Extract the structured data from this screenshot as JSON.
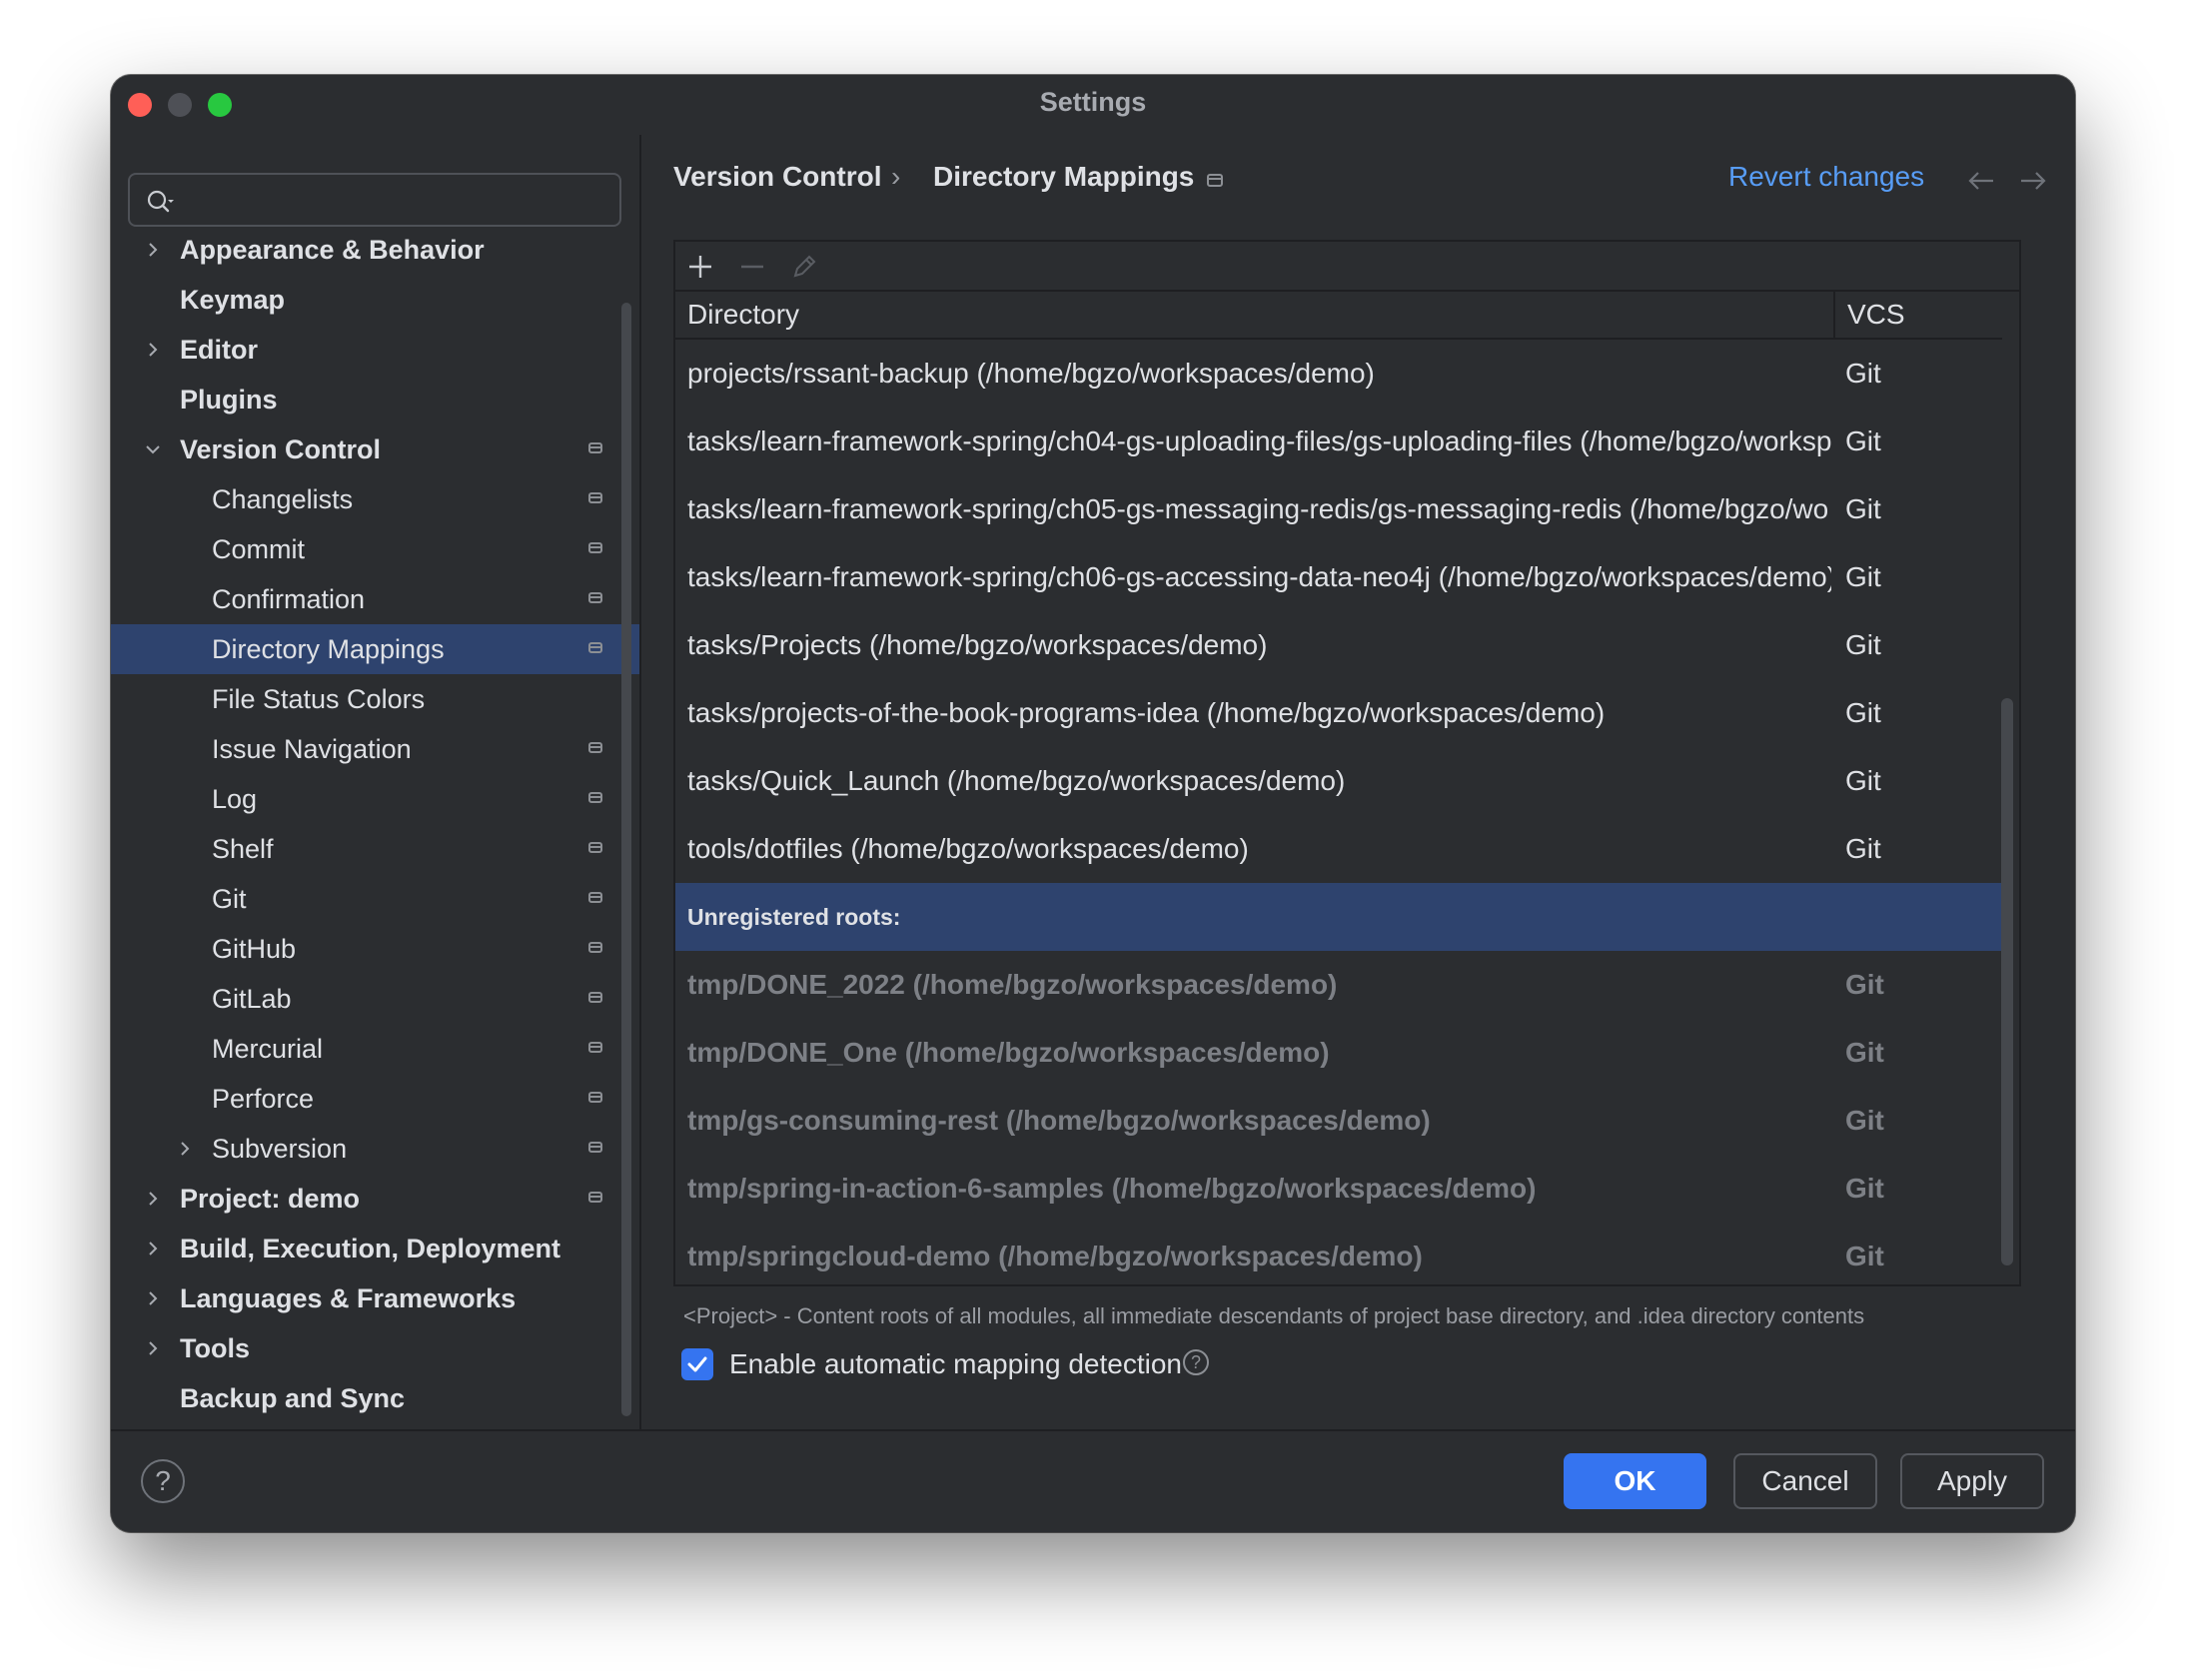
{
  "window": {
    "title": "Settings"
  },
  "search": {
    "placeholder": "",
    "value": ""
  },
  "sidebar": {
    "items": [
      {
        "label": "Appearance & Behavior",
        "level": 0,
        "expandable": true,
        "expanded": false,
        "badge": false,
        "selected": false
      },
      {
        "label": "Keymap",
        "level": 0,
        "expandable": false,
        "badge": false,
        "selected": false
      },
      {
        "label": "Editor",
        "level": 0,
        "expandable": true,
        "expanded": false,
        "badge": false,
        "selected": false
      },
      {
        "label": "Plugins",
        "level": 0,
        "expandable": false,
        "badge": false,
        "selected": false
      },
      {
        "label": "Version Control",
        "level": 0,
        "expandable": true,
        "expanded": true,
        "badge": true,
        "selected": false
      },
      {
        "label": "Changelists",
        "level": 1,
        "expandable": false,
        "badge": true,
        "selected": false
      },
      {
        "label": "Commit",
        "level": 1,
        "expandable": false,
        "badge": true,
        "selected": false
      },
      {
        "label": "Confirmation",
        "level": 1,
        "expandable": false,
        "badge": true,
        "selected": false
      },
      {
        "label": "Directory Mappings",
        "level": 1,
        "expandable": false,
        "badge": true,
        "selected": true
      },
      {
        "label": "File Status Colors",
        "level": 1,
        "expandable": false,
        "badge": false,
        "selected": false
      },
      {
        "label": "Issue Navigation",
        "level": 1,
        "expandable": false,
        "badge": true,
        "selected": false
      },
      {
        "label": "Log",
        "level": 1,
        "expandable": false,
        "badge": true,
        "selected": false
      },
      {
        "label": "Shelf",
        "level": 1,
        "expandable": false,
        "badge": true,
        "selected": false
      },
      {
        "label": "Git",
        "level": 1,
        "expandable": false,
        "badge": true,
        "selected": false
      },
      {
        "label": "GitHub",
        "level": 1,
        "expandable": false,
        "badge": true,
        "selected": false
      },
      {
        "label": "GitLab",
        "level": 1,
        "expandable": false,
        "badge": true,
        "selected": false
      },
      {
        "label": "Mercurial",
        "level": 1,
        "expandable": false,
        "badge": true,
        "selected": false
      },
      {
        "label": "Perforce",
        "level": 1,
        "expandable": false,
        "badge": true,
        "selected": false
      },
      {
        "label": "Subversion",
        "level": 1,
        "expandable": true,
        "expanded": false,
        "badge": true,
        "selected": false
      },
      {
        "label": "Project: demo",
        "level": 0,
        "expandable": true,
        "expanded": false,
        "badge": true,
        "selected": false
      },
      {
        "label": "Build, Execution, Deployment",
        "level": 0,
        "expandable": true,
        "expanded": false,
        "badge": false,
        "selected": false
      },
      {
        "label": "Languages & Frameworks",
        "level": 0,
        "expandable": true,
        "expanded": false,
        "badge": false,
        "selected": false
      },
      {
        "label": "Tools",
        "level": 0,
        "expandable": true,
        "expanded": false,
        "badge": false,
        "selected": false
      },
      {
        "label": "Backup and Sync",
        "level": 0,
        "expandable": false,
        "badge": false,
        "selected": false
      }
    ]
  },
  "header": {
    "breadcrumb": [
      "Version Control",
      "Directory Mappings"
    ],
    "separator": "›",
    "revert_label": "Revert changes"
  },
  "toolbar": {
    "add_icon": "plus-icon",
    "remove_icon": "minus-icon",
    "edit_icon": "pencil-icon"
  },
  "table": {
    "columns": [
      "Directory",
      "VCS"
    ],
    "rows": [
      {
        "directory": "projects/rssant-backup (/home/bgzo/workspaces/demo)",
        "vcs": "Git",
        "kind": "registered"
      },
      {
        "directory": "tasks/learn-framework-spring/ch04-gs-uploading-files/gs-uploading-files (/home/bgzo/worksp",
        "vcs": "Git",
        "kind": "registered"
      },
      {
        "directory": "tasks/learn-framework-spring/ch05-gs-messaging-redis/gs-messaging-redis (/home/bgzo/wo",
        "vcs": "Git",
        "kind": "registered"
      },
      {
        "directory": "tasks/learn-framework-spring/ch06-gs-accessing-data-neo4j (/home/bgzo/workspaces/demo)",
        "vcs": "Git",
        "kind": "registered"
      },
      {
        "directory": "tasks/Projects (/home/bgzo/workspaces/demo)",
        "vcs": "Git",
        "kind": "registered"
      },
      {
        "directory": "tasks/projects-of-the-book-programs-idea (/home/bgzo/workspaces/demo)",
        "vcs": "Git",
        "kind": "registered"
      },
      {
        "directory": "tasks/Quick_Launch (/home/bgzo/workspaces/demo)",
        "vcs": "Git",
        "kind": "registered"
      },
      {
        "directory": "tools/dotfiles (/home/bgzo/workspaces/demo)",
        "vcs": "Git",
        "kind": "registered"
      },
      {
        "directory": "Unregistered roots:",
        "vcs": "",
        "kind": "group"
      },
      {
        "directory": "tmp/DONE_2022 (/home/bgzo/workspaces/demo)",
        "vcs": "Git",
        "kind": "unregistered"
      },
      {
        "directory": "tmp/DONE_One (/home/bgzo/workspaces/demo)",
        "vcs": "Git",
        "kind": "unregistered"
      },
      {
        "directory": "tmp/gs-consuming-rest (/home/bgzo/workspaces/demo)",
        "vcs": "Git",
        "kind": "unregistered"
      },
      {
        "directory": "tmp/spring-in-action-6-samples (/home/bgzo/workspaces/demo)",
        "vcs": "Git",
        "kind": "unregistered"
      },
      {
        "directory": "tmp/springcloud-demo (/home/bgzo/workspaces/demo)",
        "vcs": "Git",
        "kind": "unregistered"
      }
    ]
  },
  "hint": "<Project> - Content roots of all modules, all immediate descendants of project base directory, and .idea directory contents",
  "auto_detect": {
    "label": "Enable automatic mapping detection",
    "checked": true
  },
  "footer": {
    "help_label": "?",
    "ok_label": "OK",
    "cancel_label": "Cancel",
    "apply_label": "Apply"
  },
  "colors": {
    "accent": "#3574f0",
    "selection": "#2e436e",
    "link": "#589df6",
    "background": "#2b2d30"
  }
}
